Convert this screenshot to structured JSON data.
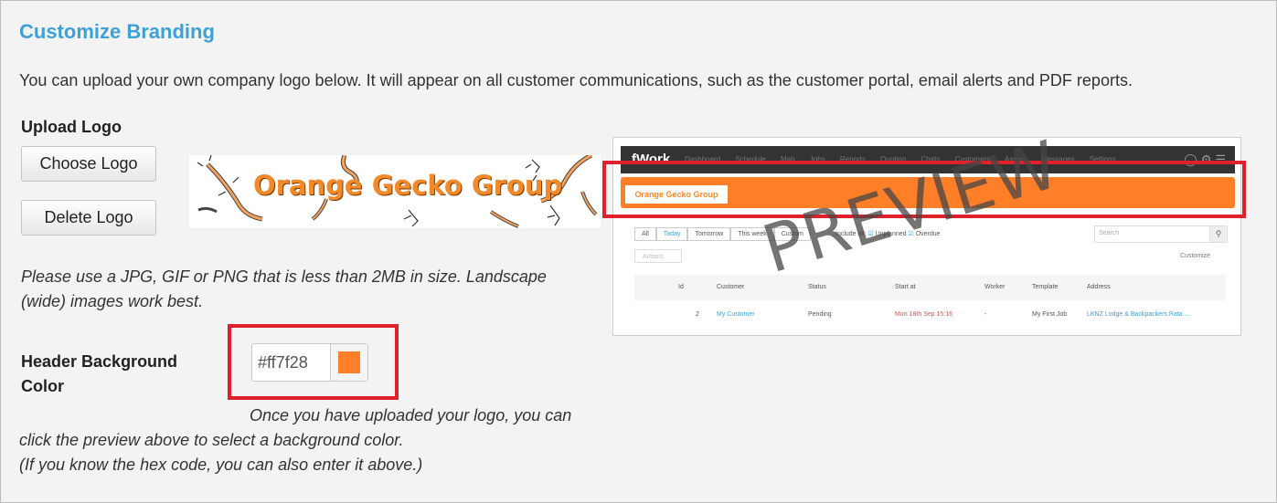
{
  "section": {
    "title": "Customize Branding",
    "intro": "You can upload your own company logo below. It will appear on all customer communications, such as the customer portal, email alerts and PDF reports."
  },
  "upload": {
    "label": "Upload Logo",
    "choose_button": "Choose Logo",
    "delete_button": "Delete Logo",
    "logo_text": "Orange Gecko Group",
    "hint_line1": "Please use a JPG, GIF or PNG that is less than 2MB in size. Landscape",
    "hint_line2": "(wide) images work best."
  },
  "header_color": {
    "label_line1": "Header Background",
    "label_line2": "Color",
    "value": "#ff7f28",
    "swatch_color": "#ff7f28",
    "note_line1": "Once you have uploaded your logo, you can",
    "note_line2": "click the preview above to select a background color.",
    "note_line3": "(If you know the hex code, you can also enter it above.)"
  },
  "preview": {
    "watermark": "PREVIEW",
    "brand": "fWork",
    "nav_items": "Dashboard Schedule Map Jobs Reports Quoting Chats Customers Assets Messages Settings",
    "logo_text": "Orange Gecko Group",
    "filters": [
      "All",
      "Today",
      "Tomorrow",
      "This week",
      "Custom"
    ],
    "include_all": "Include all:",
    "unplanned": "Unplanned",
    "overdue": "Overdue",
    "search_placeholder": "Search",
    "actions": "Actions",
    "customize": "Customize",
    "columns": [
      "Id",
      "Customer",
      "Status",
      "Start at",
      "Worker",
      "Template",
      "Address"
    ],
    "row": {
      "id": "2",
      "customer": "My Customer",
      "status": "Pending",
      "start": "Mon 18th Sep 15:16",
      "worker": "-",
      "template": "My First Job",
      "address": "LKNZ Lodge & Backpackers Rata ..."
    }
  },
  "colors": {
    "title": "#3da0d6",
    "highlight": "#e0202a",
    "brand_orange": "#ff7f28"
  }
}
